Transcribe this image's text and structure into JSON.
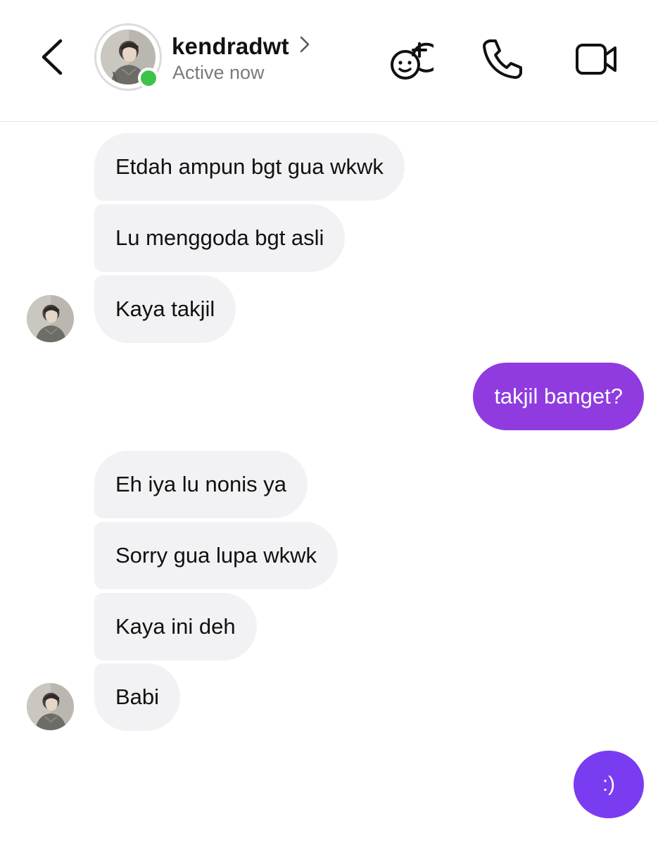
{
  "header": {
    "username": "kendradwt",
    "status": "Active now",
    "icons": {
      "back": "chevron-left-icon",
      "profile_chevron": "chevron-right-icon",
      "effects": "effects-smiley-plus-icon",
      "call": "phone-icon",
      "video": "video-camera-icon"
    },
    "online_color": "#3ec34a"
  },
  "messages": [
    {
      "from": "them",
      "text": "Etdah ampun bgt gua wkwk"
    },
    {
      "from": "them",
      "text": "Lu menggoda bgt asli"
    },
    {
      "from": "them",
      "text": "Kaya takjil"
    },
    {
      "from": "me",
      "text": "takjil banget?"
    },
    {
      "from": "them",
      "text": "Eh iya lu nonis ya"
    },
    {
      "from": "them",
      "text": "Sorry gua lupa wkwk"
    },
    {
      "from": "them",
      "text": "Kaya ini deh"
    },
    {
      "from": "them",
      "text": "Babi"
    }
  ],
  "quick_reply": {
    "label": ":)"
  },
  "colors": {
    "incoming_bubble": "#f2f2f4",
    "outgoing_bubble": "#8f3be0",
    "accent": "#7a3cf0"
  }
}
